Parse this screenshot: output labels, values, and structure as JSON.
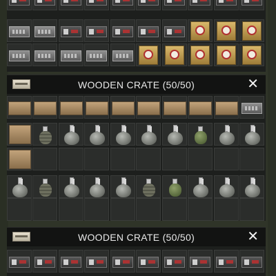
{
  "crate_panels": [
    {
      "title": "WOODEN CRATE (50/50)"
    },
    {
      "title": "WOODEN CRATE (50/50)"
    }
  ],
  "icons": {
    "crate": "wooden-crate-icon",
    "close": "close-icon"
  },
  "close_glyph": "✕"
}
